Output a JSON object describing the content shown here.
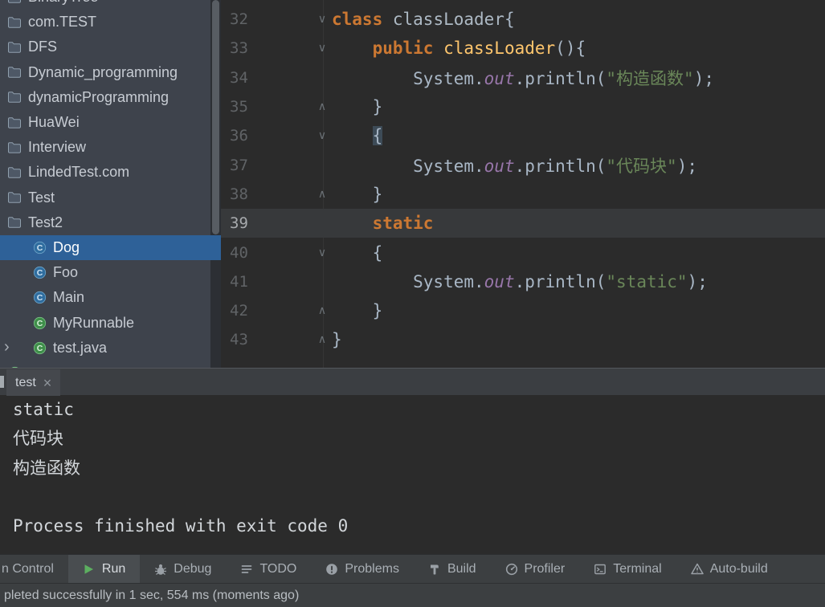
{
  "sidebar": {
    "items": [
      {
        "label": "BinaryTree",
        "icon": "folder"
      },
      {
        "label": "com.TEST",
        "icon": "folder"
      },
      {
        "label": "DFS",
        "icon": "folder"
      },
      {
        "label": "Dynamic_programming",
        "icon": "folder"
      },
      {
        "label": "dynamicProgramming",
        "icon": "folder"
      },
      {
        "label": "HuaWei",
        "icon": "folder"
      },
      {
        "label": "Interview",
        "icon": "folder"
      },
      {
        "label": "LindedTest.com",
        "icon": "folder"
      },
      {
        "label": "Test",
        "icon": "folder"
      },
      {
        "label": "Test2",
        "icon": "folder"
      },
      {
        "label": "Dog",
        "icon": "class-blue",
        "child": true,
        "selected": true
      },
      {
        "label": "Foo",
        "icon": "class-blue",
        "child": true
      },
      {
        "label": "Main",
        "icon": "class-blue",
        "child": true
      },
      {
        "label": "MyRunnable",
        "icon": "class-green",
        "child": true
      },
      {
        "label": "test.java",
        "icon": "class-green",
        "child": true,
        "chevron": true
      },
      {
        "label": "",
        "icon": "class-green"
      }
    ]
  },
  "editor": {
    "lines": [
      {
        "num": "32",
        "fold": "open",
        "tokens": [
          [
            "kw",
            "class"
          ],
          [
            "plain",
            " "
          ],
          [
            "cls",
            "classLoader"
          ],
          [
            "plain",
            "{"
          ]
        ]
      },
      {
        "num": "33",
        "fold": "open",
        "tokens": [
          [
            "plain",
            "    "
          ],
          [
            "kw",
            "public"
          ],
          [
            "plain",
            " "
          ],
          [
            "method",
            "classLoader"
          ],
          [
            "plain",
            "(){"
          ]
        ]
      },
      {
        "num": "34",
        "tokens": [
          [
            "plain",
            "        System."
          ],
          [
            "field",
            "out"
          ],
          [
            "plain",
            ".println("
          ],
          [
            "str",
            "\"构造函数\""
          ],
          [
            "plain",
            ");"
          ]
        ]
      },
      {
        "num": "35",
        "fold": "close",
        "tokens": [
          [
            "plain",
            "    }"
          ]
        ]
      },
      {
        "num": "36",
        "fold": "open",
        "tokens": [
          [
            "plain",
            "    "
          ],
          [
            "bracehl",
            "{"
          ]
        ]
      },
      {
        "num": "37",
        "tokens": [
          [
            "plain",
            "        System."
          ],
          [
            "field",
            "out"
          ],
          [
            "plain",
            ".println("
          ],
          [
            "str",
            "\"代码块\""
          ],
          [
            "plain",
            ");"
          ]
        ]
      },
      {
        "num": "38",
        "fold": "close",
        "tokens": [
          [
            "plain",
            "    }"
          ]
        ]
      },
      {
        "num": "39",
        "highlight": true,
        "tokens": [
          [
            "plain",
            "    "
          ],
          [
            "kw",
            "static"
          ]
        ]
      },
      {
        "num": "40",
        "fold": "open",
        "tokens": [
          [
            "plain",
            "    {"
          ]
        ]
      },
      {
        "num": "41",
        "tokens": [
          [
            "plain",
            "        System."
          ],
          [
            "field",
            "out"
          ],
          [
            "plain",
            ".println("
          ],
          [
            "str",
            "\"static\""
          ],
          [
            "plain",
            ");"
          ]
        ]
      },
      {
        "num": "42",
        "fold": "close",
        "tokens": [
          [
            "plain",
            "    }"
          ]
        ]
      },
      {
        "num": "43",
        "fold": "close",
        "tokens": [
          [
            "plain",
            "}"
          ]
        ]
      }
    ]
  },
  "console": {
    "tab_label": "test",
    "close_glyph": "×",
    "lines": [
      "static",
      "代码块",
      "构造函数",
      "",
      "Process finished with exit code 0"
    ]
  },
  "toolbar": {
    "items": [
      {
        "label": "n Control",
        "icon": "none"
      },
      {
        "label": "Run",
        "icon": "play",
        "active": true
      },
      {
        "label": "Debug",
        "icon": "bug"
      },
      {
        "label": "TODO",
        "icon": "list"
      },
      {
        "label": "Problems",
        "icon": "error"
      },
      {
        "label": "Build",
        "icon": "hammer"
      },
      {
        "label": "Profiler",
        "icon": "gauge"
      },
      {
        "label": "Terminal",
        "icon": "terminal"
      },
      {
        "label": "Auto-build",
        "icon": "autobuild"
      }
    ]
  },
  "statusbar": {
    "text": "pleted successfully in 1 sec, 554 ms (moments ago)"
  },
  "colors": {
    "selection_blue": "#2e6198",
    "keyword_orange": "#cc7832",
    "string_green": "#6a8759",
    "field_purple": "#9876aa",
    "run_green": "#5caf60",
    "editor_bg": "#2b2b2b",
    "panel_bg": "#3c3f41"
  }
}
